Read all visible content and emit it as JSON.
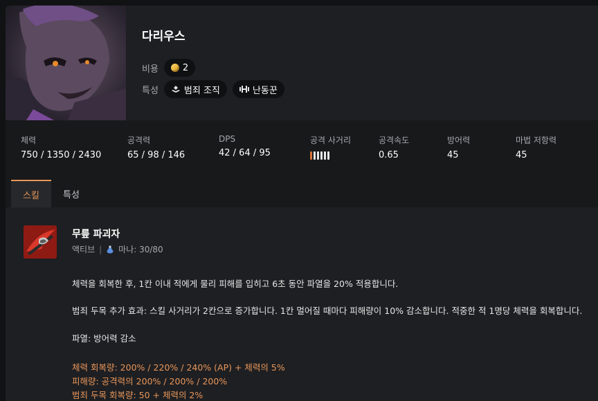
{
  "champion": {
    "name": "다리우스",
    "cost_label": "비용",
    "cost": "2",
    "traits_label": "특성",
    "traits": [
      {
        "name": "범죄 조직",
        "icon": "syndicate-icon"
      },
      {
        "name": "난동꾼",
        "icon": "brawler-icon"
      }
    ]
  },
  "stats": {
    "hp": {
      "label": "체력",
      "value": "750 / 1350 / 2430"
    },
    "ad": {
      "label": "공격력",
      "value": "65 / 98 / 146"
    },
    "dps": {
      "label": "DPS",
      "value": "42 / 64 / 95"
    },
    "range": {
      "label": "공격 사거리",
      "value": 1,
      "max": 6
    },
    "as": {
      "label": "공격속도",
      "value": "0.65"
    },
    "armor": {
      "label": "방어력",
      "value": "45"
    },
    "mr": {
      "label": "마법 저항력",
      "value": "45"
    }
  },
  "tabs": [
    {
      "label": "스킬",
      "active": true
    },
    {
      "label": "특성",
      "active": false
    }
  ],
  "skill": {
    "name": "무릎 파괴자",
    "type": "액티브",
    "separator": "|",
    "mana": "마나: 30/80",
    "lines": [
      "체력을 회복한 후, 1칸 이내 적에게 물리 피해를 입히고 6초 동안 파열을 20% 적용합니다.",
      "범죄 두목 추가 효과: 스킬 사거리가 2칸으로 증가합니다. 1칸 멀어질 때마다 피해량이 10% 감소합니다. 적중한 적 1명당 체력을 회복합니다.",
      "파열: 방어력 감소"
    ],
    "scaling": [
      "체력 회복량: 200% / 220% / 240% (AP) + 체력의 5%",
      "피해량: 공격력의 200% / 200% / 200%",
      "범죄 두목 회복량: 50 + 체력의 2%"
    ]
  },
  "colors": {
    "accent": "#e8965a",
    "background": "#1e1f22",
    "panel": "#18191b"
  }
}
